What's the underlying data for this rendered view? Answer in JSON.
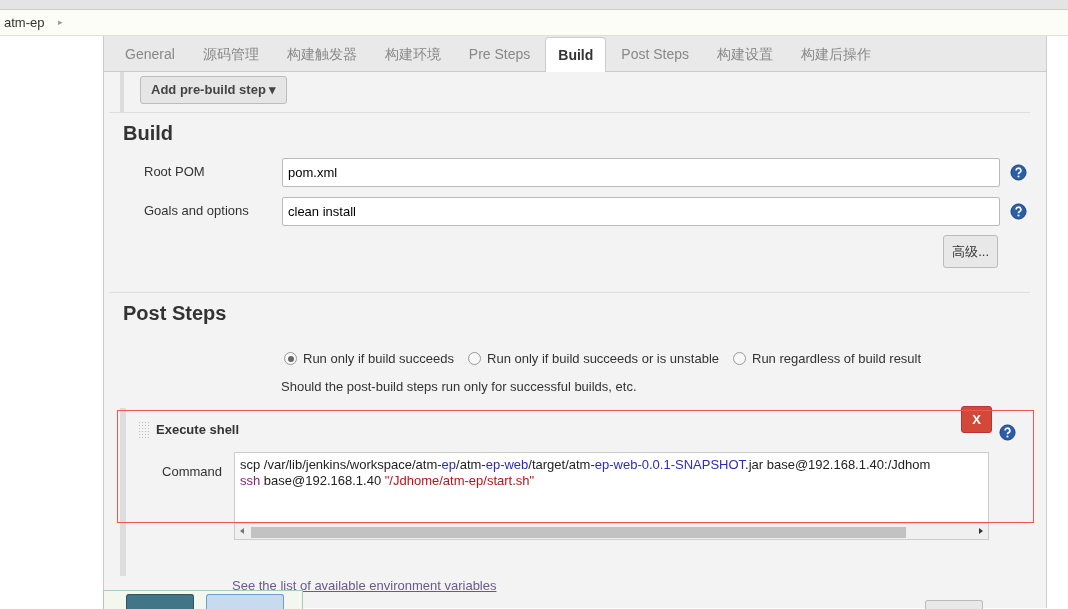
{
  "breadcrumb": {
    "items": [
      {
        "label": "atm-ep"
      }
    ],
    "separator": "▸"
  },
  "tabs": [
    {
      "label": "General",
      "selected": false
    },
    {
      "label": "源码管理",
      "selected": false
    },
    {
      "label": "构建触发器",
      "selected": false
    },
    {
      "label": "构建环境",
      "selected": false
    },
    {
      "label": "Pre Steps",
      "selected": false
    },
    {
      "label": "Build",
      "selected": true
    },
    {
      "label": "Post Steps",
      "selected": false
    },
    {
      "label": "构建设置",
      "selected": false
    },
    {
      "label": "构建后操作",
      "selected": false
    }
  ],
  "pre_build": {
    "button": "Add pre-build step",
    "caret": "▾"
  },
  "build": {
    "title": "Build",
    "fields": [
      {
        "label": "Root POM",
        "value": "pom.xml"
      },
      {
        "label": "Goals and options",
        "value": "clean install"
      }
    ],
    "advanced_button": "高级..."
  },
  "post_steps": {
    "title": "Post Steps",
    "options": [
      {
        "label": "Run only if build succeeds",
        "selected": true
      },
      {
        "label": "Run only if build succeeds or is unstable",
        "selected": false
      },
      {
        "label": "Run regardless of build result",
        "selected": false
      }
    ],
    "hint": "Should the post-build steps run only for successful builds, etc."
  },
  "execute_shell": {
    "title": "Execute shell",
    "delete_button": "X",
    "command_label": "Command",
    "command_lines": [
      [
        {
          "text": "scp /var/lib/jenkins/workspace/atm-",
          "kind": "plain"
        },
        {
          "text": "ep",
          "kind": "name"
        },
        {
          "text": "/atm-",
          "kind": "plain"
        },
        {
          "text": "ep-web",
          "kind": "name"
        },
        {
          "text": "/target/atm-",
          "kind": "plain"
        },
        {
          "text": "ep-web-0.0.1-SNAPSHOT",
          "kind": "name"
        },
        {
          "text": ".jar base@192.168.1.40:/Jdhom",
          "kind": "plain"
        }
      ],
      [
        {
          "text": "ssh",
          "kind": "command"
        },
        {
          "text": " base@192.168.1.40 ",
          "kind": "plain"
        },
        {
          "text": "\"/Jdhome/atm-ep/start.sh\"",
          "kind": "string"
        }
      ]
    ],
    "env_hint": "See the list of available environment variables"
  }
}
